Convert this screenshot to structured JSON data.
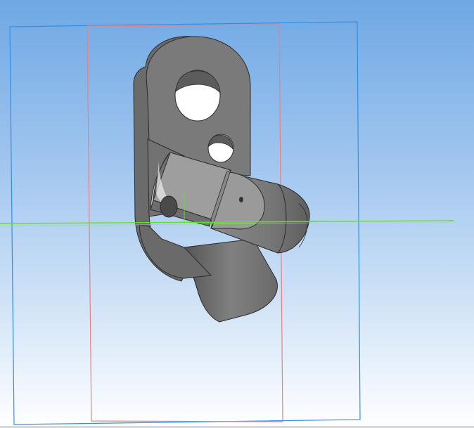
{
  "viewport": {
    "background_top": "#6fa8e4",
    "background_bottom": "#ffffff"
  },
  "scene": {
    "planes": [
      {
        "name": "front-plane",
        "color": "#2f8fe8"
      },
      {
        "name": "side-plane",
        "color": "#e88080"
      }
    ],
    "axis_color": "#66dd33",
    "part_color": "#7a7a7a",
    "edge_color": "#2a2a2a"
  }
}
